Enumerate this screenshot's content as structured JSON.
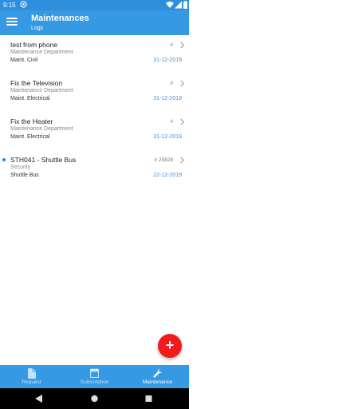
{
  "status_bar": {
    "time": "9:15"
  },
  "app_bar": {
    "title": "Maintenances",
    "subtitle": "Logs"
  },
  "logs": [
    {
      "name": "test from phone",
      "department": "Maintenance Department",
      "category": "Maint. Civil",
      "number": "#",
      "date": "31-12-2019",
      "unread": false
    },
    {
      "name": "Fix the Television",
      "department": "Maintenance Department",
      "category": "Maint. Electrical",
      "number": "#",
      "date": "31-12-2019",
      "unread": false
    },
    {
      "name": "Fix the Heater",
      "department": "Maintenance Department",
      "category": "Maint. Electrical",
      "number": "#",
      "date": "31-12-2019",
      "unread": false
    },
    {
      "name": "STH041 - Shuttle Bus",
      "department": "Security",
      "category": "Shuttle Bus",
      "number": "# 25828",
      "date": "22-12-2019",
      "unread": true
    }
  ],
  "fab": {
    "icon": "plus-icon",
    "symbol": "+"
  },
  "bottom_nav": {
    "tabs": [
      {
        "label": "Request",
        "icon": "document-icon",
        "active": false
      },
      {
        "label": "Subscription",
        "icon": "calendar-icon",
        "active": false
      },
      {
        "label": "Maintenance",
        "icon": "wrench-icon",
        "active": true
      }
    ]
  },
  "colors": {
    "primary": "#3699e3",
    "fab": "#f21b1b",
    "date": "#4a90d9",
    "unread_dot": "#1e88e5"
  }
}
